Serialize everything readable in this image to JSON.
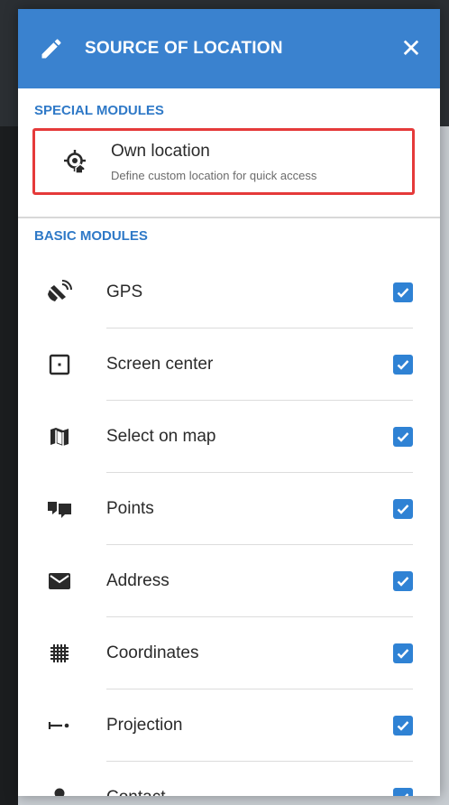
{
  "dialog": {
    "title": "SOURCE OF LOCATION",
    "close_glyph": "✕",
    "header_color": "#3a82cf",
    "accent_color": "#2f79c7",
    "highlight_color": "#e53a3a"
  },
  "special": {
    "label": "SPECIAL MODULES",
    "item": {
      "title": "Own location",
      "subtitle": "Define custom location for quick access",
      "icon": "own-location-icon"
    }
  },
  "basic": {
    "label": "BASIC MODULES",
    "items": [
      {
        "label": "GPS",
        "icon": "gps-satellite-icon",
        "checked": true
      },
      {
        "label": "Screen center",
        "icon": "screen-center-icon",
        "checked": true
      },
      {
        "label": "Select on map",
        "icon": "map-icon",
        "checked": true
      },
      {
        "label": "Points",
        "icon": "points-icon",
        "checked": true
      },
      {
        "label": "Address",
        "icon": "envelope-icon",
        "checked": true
      },
      {
        "label": "Coordinates",
        "icon": "grid-icon",
        "checked": true
      },
      {
        "label": "Projection",
        "icon": "projection-icon",
        "checked": true
      },
      {
        "label": "Contact",
        "icon": "contact-icon",
        "checked": true
      }
    ]
  }
}
